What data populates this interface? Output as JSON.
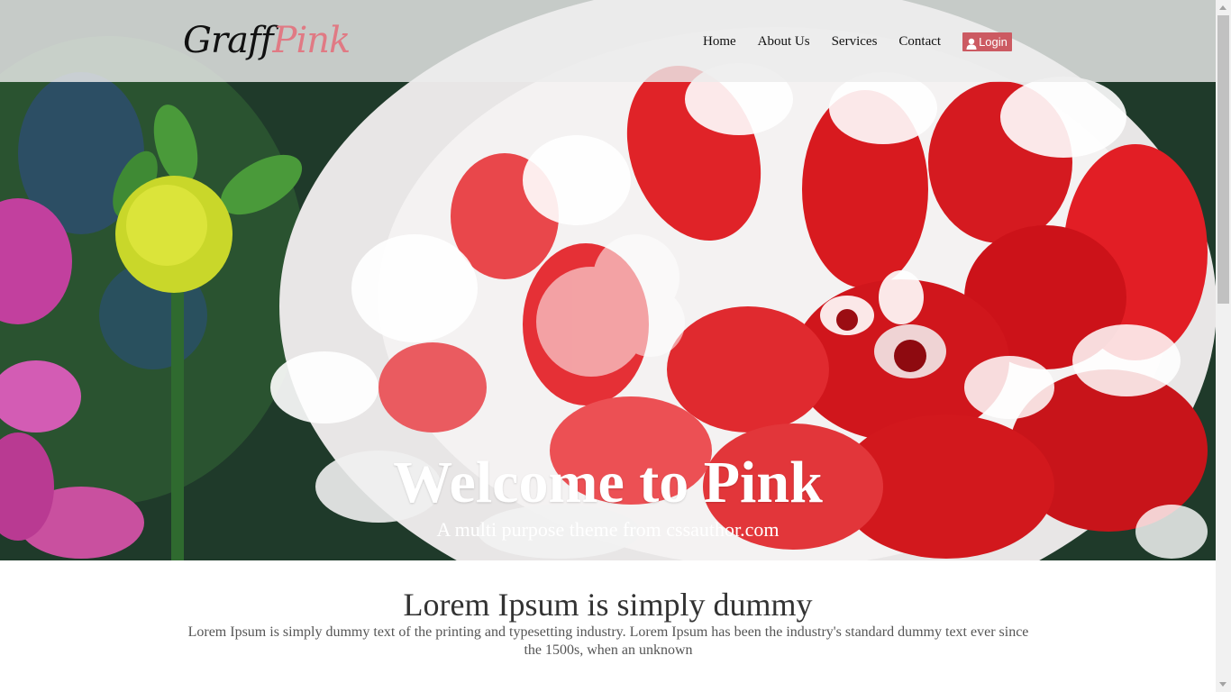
{
  "header": {
    "logo_part1": "Graff",
    "logo_part2": "Pink",
    "nav": [
      {
        "label": "Home"
      },
      {
        "label": "About Us"
      },
      {
        "label": "Services"
      },
      {
        "label": "Contact"
      }
    ],
    "login_label": "Login"
  },
  "hero": {
    "title": "Welcome to Pink",
    "subtitle": "A multi purpose theme from cssauthor.com"
  },
  "content": {
    "heading": "Lorem Ipsum is simply dummy",
    "body": "Lorem Ipsum is simply dummy text of the printing and typesetting industry. Lorem Ipsum has been the industry's standard dummy text ever since the 1500s, when an unknown"
  },
  "colors": {
    "accent": "#cc5a62",
    "logo_accent": "#e07a84",
    "header_bg": "#ebebeb"
  },
  "icons": {
    "login": "user-icon",
    "hero_logo": "overlapping-circles-icon"
  }
}
